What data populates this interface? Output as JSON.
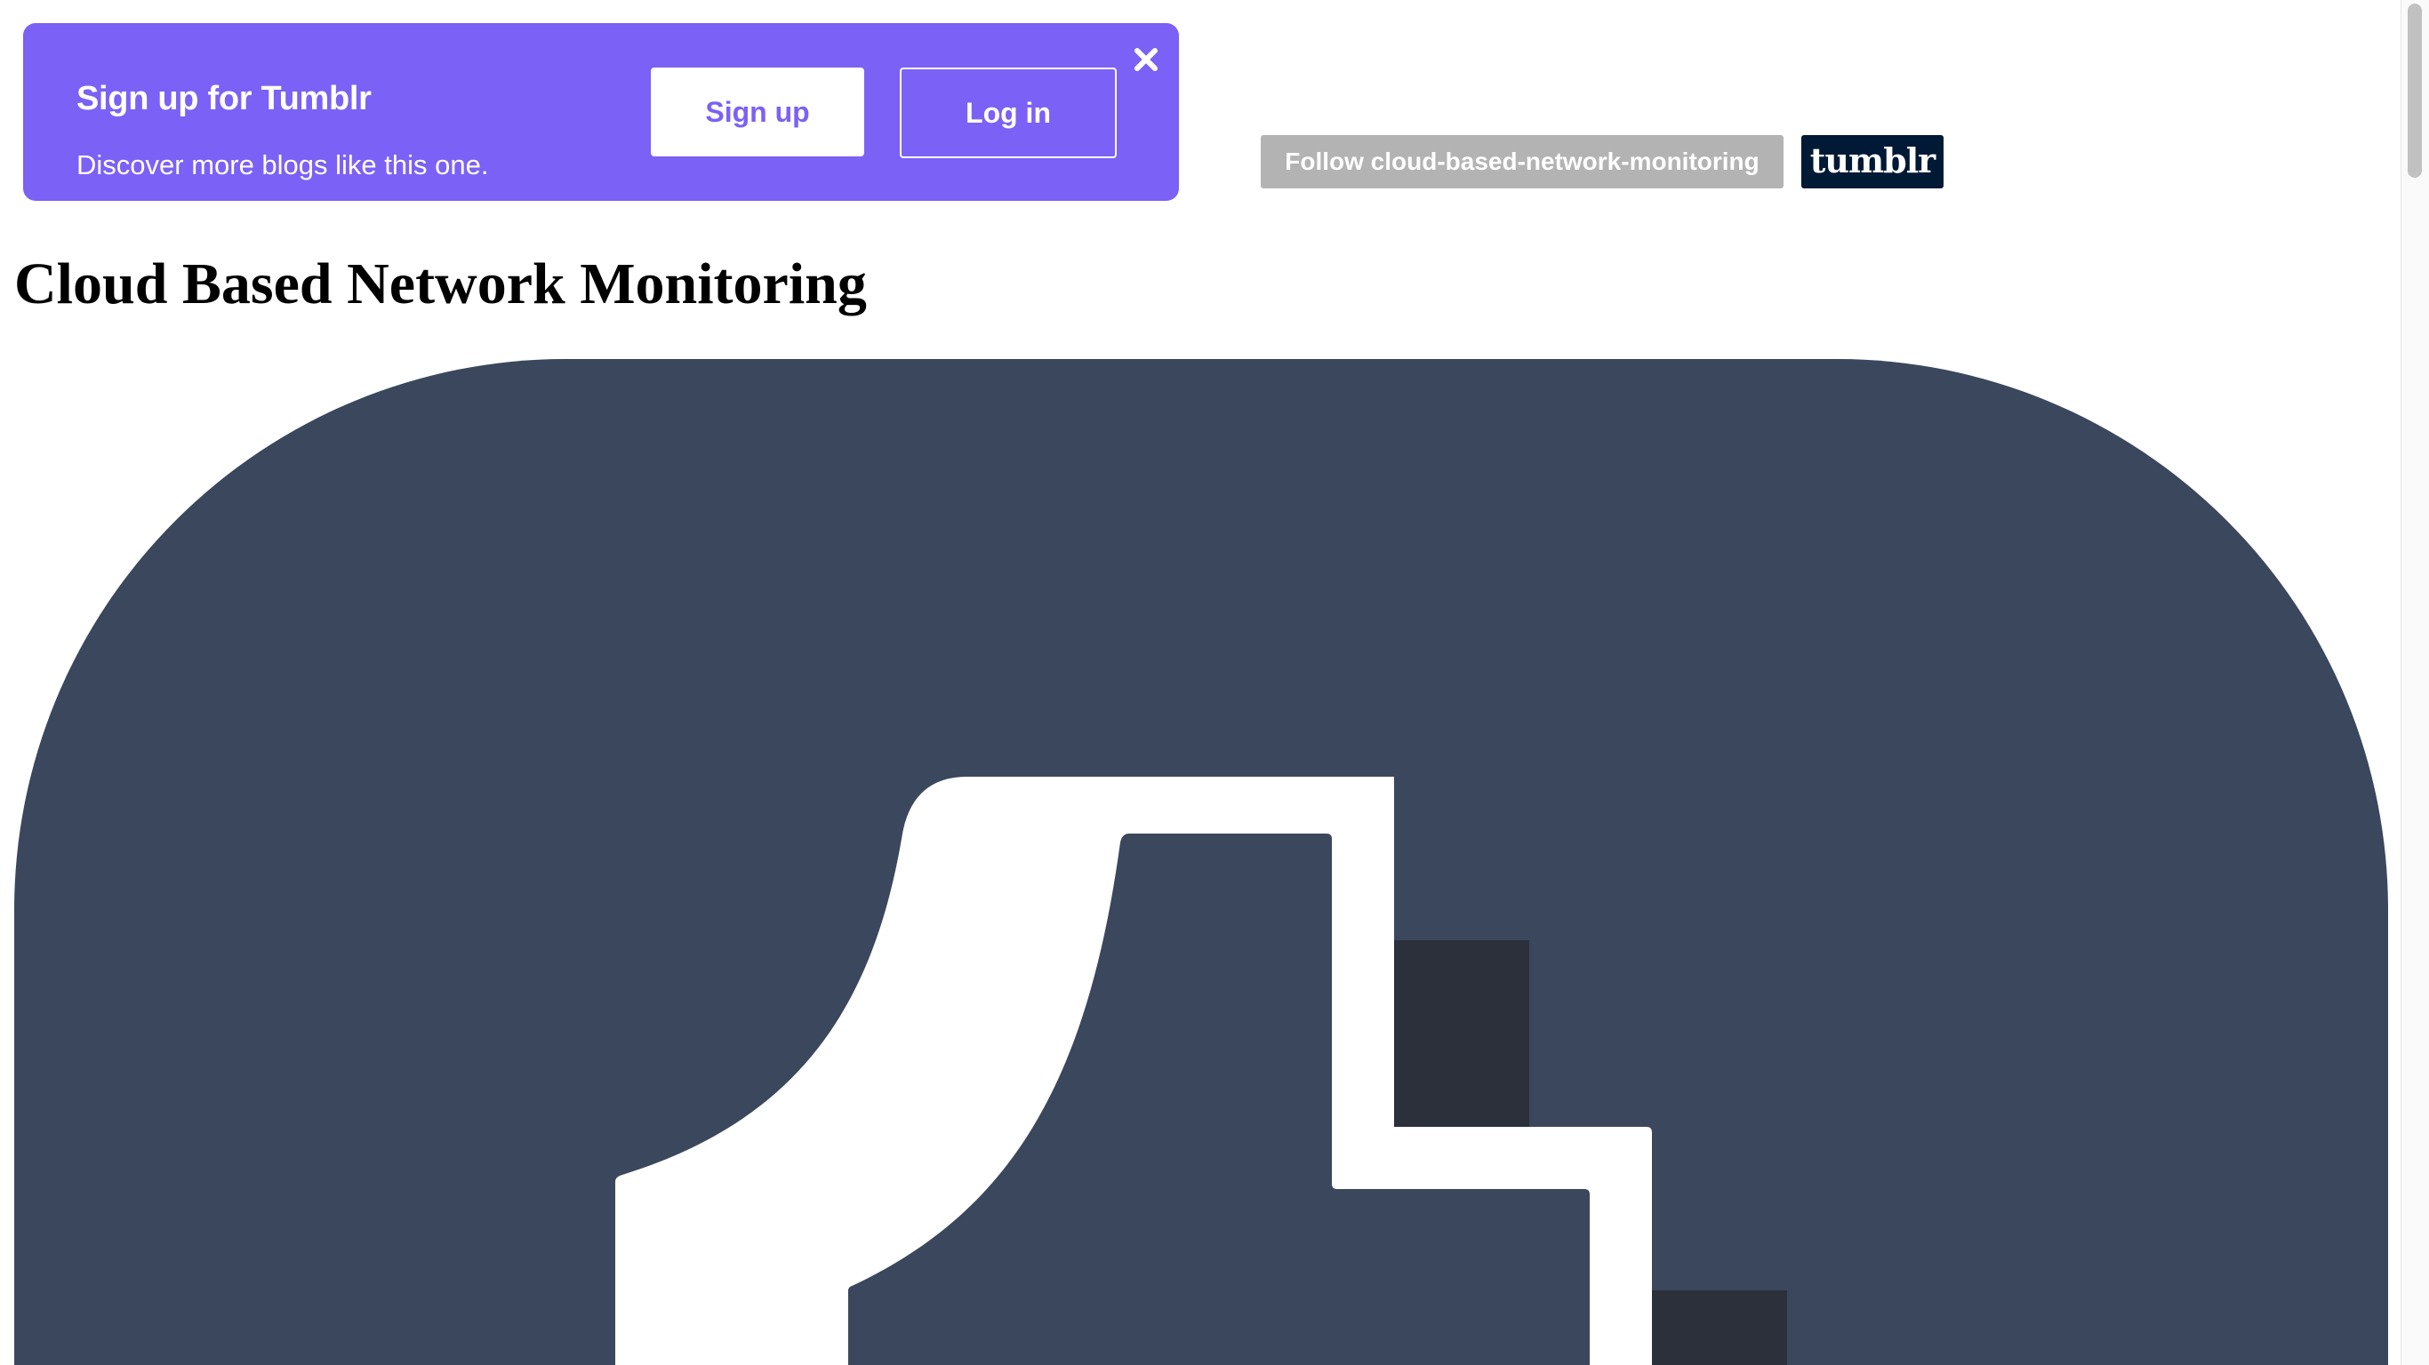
{
  "signup_banner": {
    "title": "Sign up for Tumblr",
    "subtitle": "Discover more blogs like this one.",
    "signup_label": "Sign up",
    "login_label": "Log in",
    "close_icon": "close-icon",
    "background_color": "#7b61f5"
  },
  "follow_bar": {
    "follow_label": "Follow cloud-based-network-monitoring",
    "logo_text": "tumblr",
    "logo_color": "#001935"
  },
  "page": {
    "title": "Cloud Based Network Monitoring"
  },
  "avatar": {
    "icon": "tumblr-default-avatar-icon",
    "background_color": "#3a475c",
    "figure_color": "#ffffff",
    "shadow_color": "#2b303b"
  }
}
